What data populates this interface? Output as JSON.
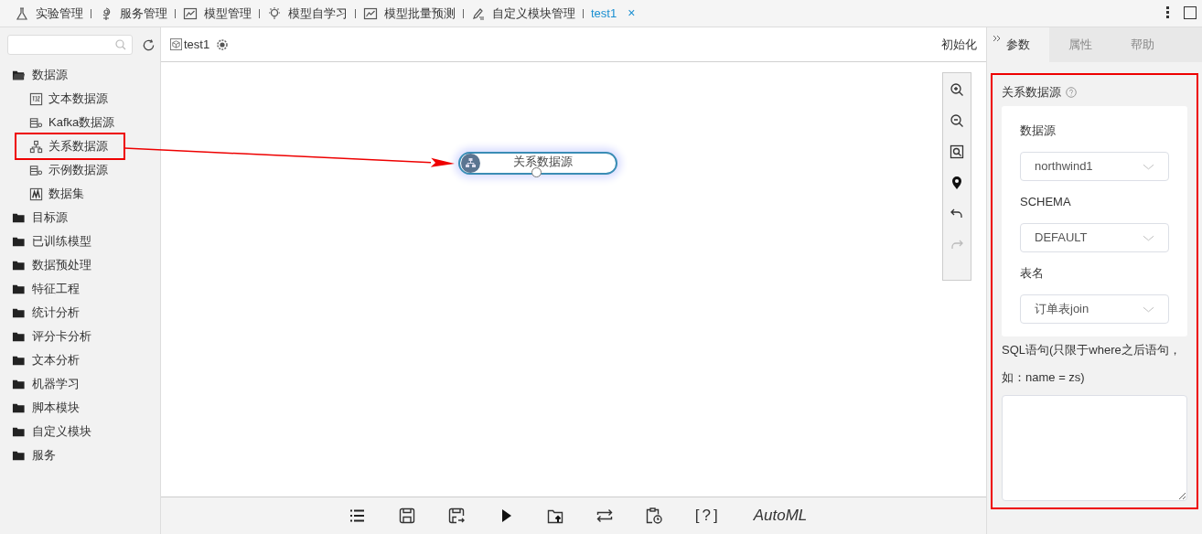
{
  "tabs": [
    {
      "label": "实验管理",
      "kind": "flask",
      "selected": false
    },
    {
      "label": "服务管理",
      "kind": "service",
      "selected": false
    },
    {
      "label": "模型管理",
      "kind": "chart",
      "selected": false
    },
    {
      "label": "模型自学习",
      "kind": "bulb",
      "selected": false
    },
    {
      "label": "模型批量预测",
      "kind": "chart",
      "selected": false
    },
    {
      "label": "自定义模块管理",
      "kind": "pen",
      "selected": false
    },
    {
      "label": "test1",
      "kind": "plain",
      "selected": true,
      "close": "×"
    }
  ],
  "sidebar": {
    "tree": [
      {
        "label": "数据源",
        "expanded": true,
        "children": [
          {
            "label": "文本数据源",
            "kind": "text",
            "highlighted": false
          },
          {
            "label": "Kafka数据源",
            "kind": "db",
            "highlighted": false
          },
          {
            "label": "关系数据源",
            "kind": "relation",
            "highlighted": true
          },
          {
            "label": "示例数据源",
            "kind": "db",
            "highlighted": false
          },
          {
            "label": "数据集",
            "kind": "dataset",
            "highlighted": false
          }
        ]
      },
      {
        "label": "目标源",
        "expanded": false
      },
      {
        "label": "已训练模型",
        "expanded": false
      },
      {
        "label": "数据预处理",
        "expanded": false
      },
      {
        "label": "特征工程",
        "expanded": false
      },
      {
        "label": "统计分析",
        "expanded": false
      },
      {
        "label": "评分卡分析",
        "expanded": false
      },
      {
        "label": "文本分析",
        "expanded": false
      },
      {
        "label": "机器学习",
        "expanded": false
      },
      {
        "label": "脚本模块",
        "expanded": false
      },
      {
        "label": "自定义模块",
        "expanded": false
      },
      {
        "label": "服务",
        "expanded": false
      }
    ]
  },
  "canvas": {
    "title": "test1",
    "action": "初始化",
    "node": {
      "label": "关系数据源",
      "selected": true,
      "annotated": true
    },
    "zoom_tools": [
      {
        "kind": "zoom-in",
        "disabled": false
      },
      {
        "kind": "zoom-out",
        "disabled": false
      },
      {
        "kind": "fit",
        "disabled": false
      },
      {
        "kind": "locate",
        "disabled": false
      },
      {
        "kind": "undo",
        "disabled": false
      },
      {
        "kind": "redo",
        "disabled": true
      }
    ],
    "bottom_tools": [
      {
        "kind": "list"
      },
      {
        "kind": "save"
      },
      {
        "kind": "save-as"
      },
      {
        "kind": "run"
      },
      {
        "kind": "export"
      },
      {
        "kind": "swap"
      },
      {
        "kind": "schedule"
      },
      {
        "kind": "text",
        "label": "[?]"
      },
      {
        "kind": "text",
        "label": "AutoML",
        "italic": true
      }
    ]
  },
  "right_panel": {
    "tabs": [
      {
        "label": "参数",
        "selected": true
      },
      {
        "label": "属性",
        "selected": false
      },
      {
        "label": "帮助",
        "selected": false
      }
    ],
    "highlighted": true,
    "section_title": "关系数据源",
    "fields": [
      {
        "label": "数据源",
        "value": "northwind1"
      },
      {
        "label": "SCHEMA",
        "value": "DEFAULT"
      },
      {
        "label": "表名",
        "value": "订单表join"
      }
    ],
    "sql_label": [
      "SQL语句(只限于where之后语句，",
      "如：name = zs)"
    ]
  }
}
